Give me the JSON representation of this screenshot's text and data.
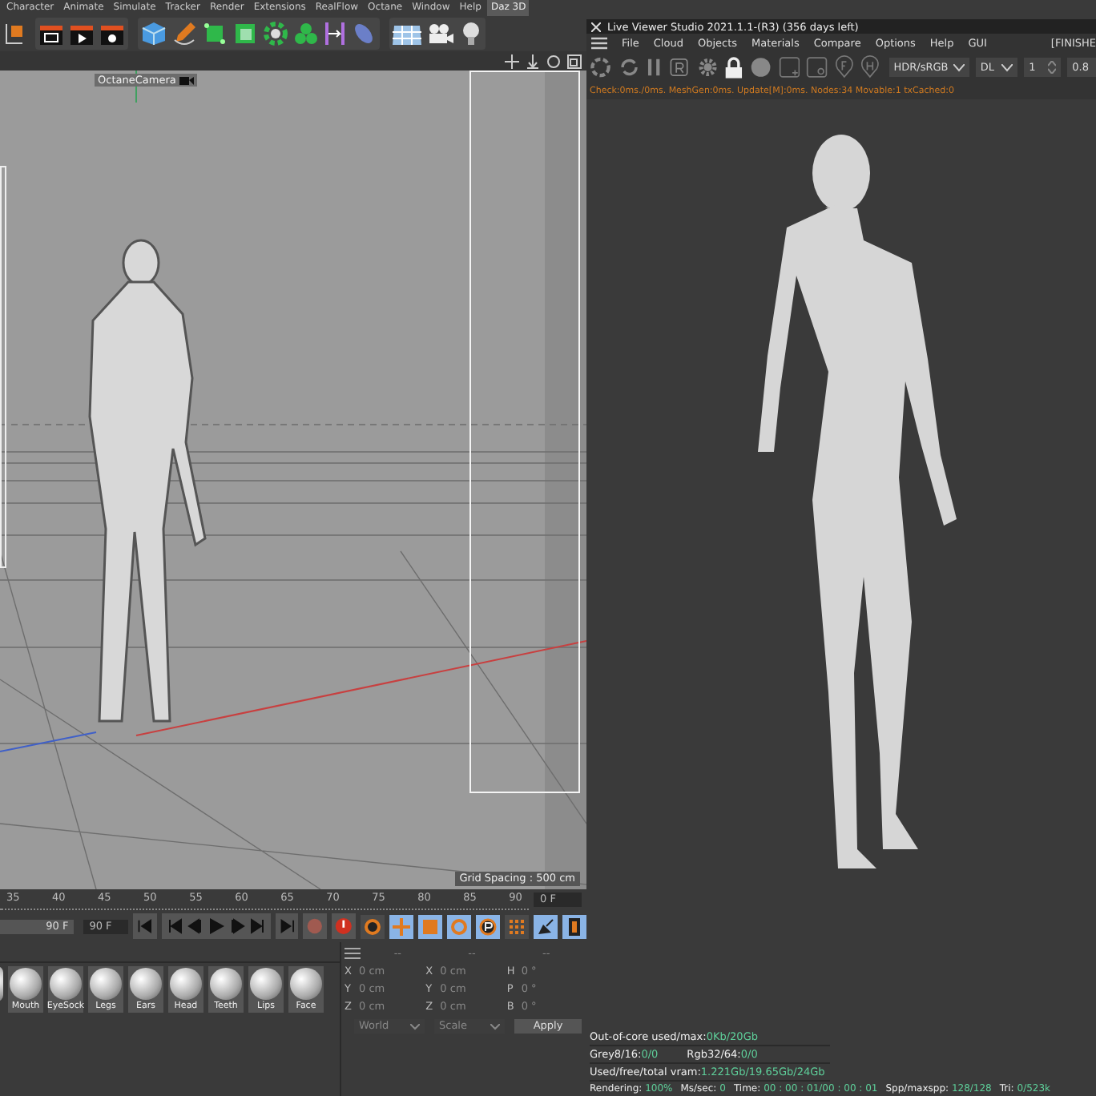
{
  "left": {
    "menu": [
      {
        "label": "Character",
        "selected": false
      },
      {
        "label": "Animate",
        "selected": false
      },
      {
        "label": "Simulate",
        "selected": false
      },
      {
        "label": "Tracker",
        "selected": false
      },
      {
        "label": "Render",
        "selected": false
      },
      {
        "label": "Extensions",
        "selected": false
      },
      {
        "label": "RealFlow",
        "selected": false
      },
      {
        "label": "Octane",
        "selected": false
      },
      {
        "label": "Window",
        "selected": false
      },
      {
        "label": "Help",
        "selected": false
      },
      {
        "label": "Daz 3D",
        "selected": true
      }
    ],
    "viewport": {
      "camera_label": "OctaneCamera",
      "grid_spacing": "Grid Spacing : 500 cm"
    },
    "timeline": {
      "ticks": [
        "35",
        "40",
        "45",
        "50",
        "55",
        "60",
        "65",
        "70",
        "75",
        "80",
        "85",
        "90"
      ],
      "current_frame": "0 F",
      "end_frame": "90 F",
      "max_frame": "90 F",
      "range_slider": {
        "level": 1
      }
    },
    "tool_toggles": [
      {
        "on": false
      },
      {
        "on": true
      },
      {
        "on": true
      },
      {
        "on": true
      },
      {
        "on": true
      },
      {
        "on": false
      },
      {
        "on": true
      },
      {
        "on": true
      }
    ],
    "materials": [
      "Mouth",
      "EyeSock",
      "Legs",
      "Ears",
      "Head",
      "Teeth",
      "Lips",
      "Face"
    ],
    "coordinates": {
      "headers": [
        "--",
        "--",
        "--"
      ],
      "columns": [
        [
          {
            "label": "X",
            "value": "0 cm"
          },
          {
            "label": "Y",
            "value": "0 cm"
          },
          {
            "label": "Z",
            "value": "0 cm"
          }
        ],
        [
          {
            "label": "X",
            "value": "0 cm"
          },
          {
            "label": "Y",
            "value": "0 cm"
          },
          {
            "label": "Z",
            "value": "0 cm"
          }
        ],
        [
          {
            "label": "H",
            "value": "0 °"
          },
          {
            "label": "P",
            "value": "0 °"
          },
          {
            "label": "B",
            "value": "0 °"
          }
        ]
      ],
      "space": "World",
      "mode": "Scale",
      "apply": "Apply"
    }
  },
  "right": {
    "title": "Live Viewer Studio 2021.1.1-(R3) (356 days left)",
    "menu": [
      "File",
      "Cloud",
      "Objects",
      "Materials",
      "Compare",
      "Options",
      "Help",
      "GUI"
    ],
    "status_tag": "[FINISHE",
    "tonemap": "HDR/sRGB",
    "kernel": "DL",
    "value_1": "1",
    "value_2": "0.8",
    "status_line": "Check:0ms./0ms. MeshGen:0ms. Update[M]:0ms. Nodes:34 Movable:1 txCached:0",
    "stats": [
      [
        {
          "label": "Out-of-core used/max:",
          "value": "0Kb/20Gb"
        }
      ],
      [
        {
          "label": "Grey8/16:",
          "value": "0/0"
        },
        {
          "label": "Rgb32/64:",
          "value": "0/0"
        }
      ],
      [
        {
          "label": "Used/free/total vram:",
          "value": "1.221Gb/19.65Gb/24Gb"
        }
      ]
    ],
    "render_line": [
      {
        "label": "Rendering:",
        "value": "100%"
      },
      {
        "label": "Ms/sec:",
        "value": "0"
      },
      {
        "label": "Time:",
        "value": "00 : 00 : 01/00 : 00 : 01"
      },
      {
        "label": "Spp/maxspp:",
        "value": "128/128"
      },
      {
        "label": "Tri:",
        "value": "0/523k"
      }
    ]
  }
}
